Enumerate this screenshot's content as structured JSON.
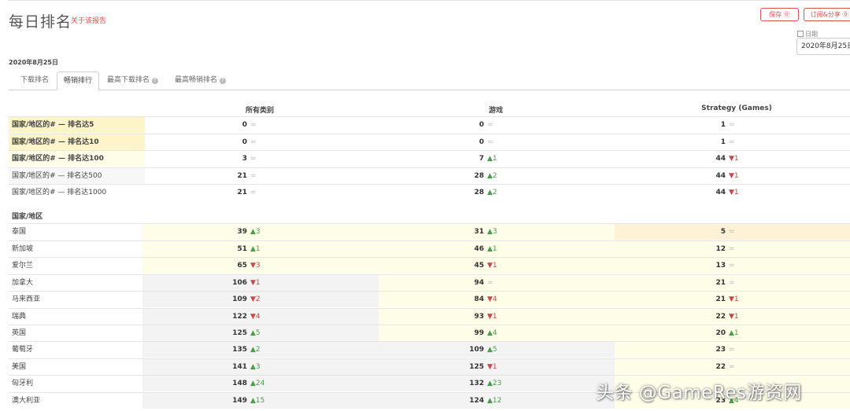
{
  "header": {
    "title": "每日排名",
    "about_link": "关于该报告",
    "save_button": "保存 ⓪",
    "share_button": "订阅&分享 ⓪",
    "date_caption": "日期",
    "date_value": "2020年8月25日"
  },
  "current_date": "2020年8月25日",
  "tabs": [
    {
      "label": "下载排名",
      "active": false
    },
    {
      "label": "畅销排行",
      "active": true
    },
    {
      "label": "最高下载排名",
      "active": false,
      "help": "?"
    },
    {
      "label": "最高畅销排名",
      "active": false,
      "help": "?"
    }
  ],
  "columns": [
    "所有类别",
    "游戏",
    "Strategy (Games)"
  ],
  "summary_rows": [
    {
      "label": "国家/地区的# — 排名达5",
      "cells": [
        {
          "v": "0",
          "c": "=",
          "d": "eq"
        },
        {
          "v": "0",
          "c": "=",
          "d": "eq"
        },
        {
          "v": "1",
          "c": "=",
          "d": "eq"
        }
      ]
    },
    {
      "label": "国家/地区的# — 排名达10",
      "cells": [
        {
          "v": "0",
          "c": "=",
          "d": "eq"
        },
        {
          "v": "0",
          "c": "=",
          "d": "eq"
        },
        {
          "v": "1",
          "c": "=",
          "d": "eq"
        }
      ]
    },
    {
      "label": "国家/地区的# — 排名达100",
      "cells": [
        {
          "v": "3",
          "c": "=",
          "d": "eq"
        },
        {
          "v": "7",
          "c": "▲1",
          "d": "up"
        },
        {
          "v": "44",
          "c": "▼1",
          "d": "down"
        }
      ]
    },
    {
      "label": "国家/地区的# — 排名达500",
      "cells": [
        {
          "v": "21",
          "c": "=",
          "d": "eq"
        },
        {
          "v": "28",
          "c": "▲2",
          "d": "up"
        },
        {
          "v": "44",
          "c": "▼1",
          "d": "down"
        }
      ]
    },
    {
      "label": "国家/地区的# — 排名达1000",
      "cells": [
        {
          "v": "21",
          "c": "=",
          "d": "eq"
        },
        {
          "v": "28",
          "c": "▲2",
          "d": "up"
        },
        {
          "v": "44",
          "c": "▼1",
          "d": "down"
        }
      ]
    }
  ],
  "country_section_label": "国家/地区",
  "country_rows": [
    {
      "label": "泰国",
      "cells": [
        {
          "v": "39",
          "c": "▲3",
          "d": "up"
        },
        {
          "v": "31",
          "c": "▲3",
          "d": "up"
        },
        {
          "v": "5",
          "c": "=",
          "d": "eq"
        }
      ]
    },
    {
      "label": "新加坡",
      "cells": [
        {
          "v": "51",
          "c": "▲1",
          "d": "up"
        },
        {
          "v": "46",
          "c": "▲1",
          "d": "up"
        },
        {
          "v": "12",
          "c": "=",
          "d": "eq"
        }
      ]
    },
    {
      "label": "爱尔兰",
      "cells": [
        {
          "v": "65",
          "c": "▼3",
          "d": "down"
        },
        {
          "v": "45",
          "c": "▼1",
          "d": "down"
        },
        {
          "v": "13",
          "c": "=",
          "d": "eq"
        }
      ]
    },
    {
      "label": "加拿大",
      "cells": [
        {
          "v": "106",
          "c": "▼1",
          "d": "down"
        },
        {
          "v": "94",
          "c": "=",
          "d": "eq"
        },
        {
          "v": "21",
          "c": "=",
          "d": "eq"
        }
      ]
    },
    {
      "label": "马来西亚",
      "cells": [
        {
          "v": "109",
          "c": "▼2",
          "d": "down"
        },
        {
          "v": "84",
          "c": "▼4",
          "d": "down"
        },
        {
          "v": "21",
          "c": "▼1",
          "d": "down"
        }
      ]
    },
    {
      "label": "瑞典",
      "cells": [
        {
          "v": "122",
          "c": "▼4",
          "d": "down"
        },
        {
          "v": "93",
          "c": "▼1",
          "d": "down"
        },
        {
          "v": "22",
          "c": "▼1",
          "d": "down"
        }
      ]
    },
    {
      "label": "英国",
      "cells": [
        {
          "v": "125",
          "c": "▲5",
          "d": "up"
        },
        {
          "v": "99",
          "c": "▲4",
          "d": "up"
        },
        {
          "v": "20",
          "c": "▲1",
          "d": "up"
        }
      ]
    },
    {
      "label": "葡萄牙",
      "cells": [
        {
          "v": "135",
          "c": "▲2",
          "d": "up"
        },
        {
          "v": "109",
          "c": "▲5",
          "d": "up"
        },
        {
          "v": "23",
          "c": "=",
          "d": "eq"
        }
      ]
    },
    {
      "label": "美国",
      "cells": [
        {
          "v": "141",
          "c": "▲3",
          "d": "up"
        },
        {
          "v": "125",
          "c": "▼1",
          "d": "down"
        },
        {
          "v": "22",
          "c": "=",
          "d": "eq"
        }
      ]
    },
    {
      "label": "匈牙利",
      "cells": [
        {
          "v": "148",
          "c": "▲24",
          "d": "up"
        },
        {
          "v": "132",
          "c": "▲23",
          "d": "up"
        },
        {
          "v": "",
          "c": "",
          "d": "eq"
        }
      ]
    },
    {
      "label": "澳大利亚",
      "cells": [
        {
          "v": "149",
          "c": "▲15",
          "d": "up"
        },
        {
          "v": "124",
          "c": "▲12",
          "d": "up"
        },
        {
          "v": "23",
          "c": "▲4",
          "d": "up"
        }
      ]
    }
  ],
  "watermark": "头条 @GameRes游资网",
  "colors": {
    "accent": "#d9534f",
    "up": "#4a9e4a",
    "down": "#c9474a",
    "highlight_strong": "#fdf5c9",
    "highlight_light": "#fefde8",
    "gray_cell": "#f3f3f3",
    "orange_cell": "#fdf1d6"
  }
}
